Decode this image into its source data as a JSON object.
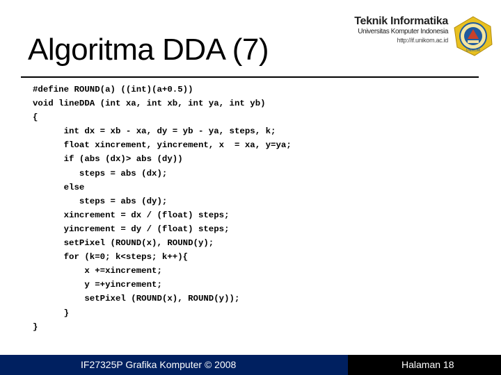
{
  "slide": {
    "title": "Algoritma DDA (7)",
    "logo": {
      "title": "Teknik Informatika",
      "subtitle": "Universitas Komputer Indonesia",
      "url": "http://if.unikom.ac.id",
      "emblem_icon": "university-emblem-icon",
      "emblem_label": "UNIKOM"
    },
    "code_lines": [
      "#define ROUND(a) ((int)(a+0.5))",
      "void lineDDA (int xa, int xb, int ya, int yb)",
      "{",
      "      int dx = xb - xa, dy = yb - ya, steps, k;",
      "      float xincrement, yincrement, x  = xa, y=ya;",
      "      if (abs (dx)> abs (dy))",
      "         steps = abs (dx);",
      "      else",
      "         steps = abs (dy);",
      "      xincrement = dx / (float) steps;",
      "      yincrement = dy / (float) steps;",
      "      setPixel (ROUND(x), ROUND(y);",
      "      for (k=0; k<steps; k++){",
      "          x +=xincrement;",
      "          y =+yincrement;",
      "          setPixel (ROUND(x), ROUND(y));",
      "      }",
      "}"
    ],
    "footer": {
      "course": "IF27325P Grafika Komputer © 2008",
      "page": "Halaman  18"
    },
    "colors": {
      "footer_left": "#002060",
      "footer_right": "#000000",
      "emblem_outer": "#e8c020",
      "emblem_inner": "#1f5a9e"
    }
  }
}
